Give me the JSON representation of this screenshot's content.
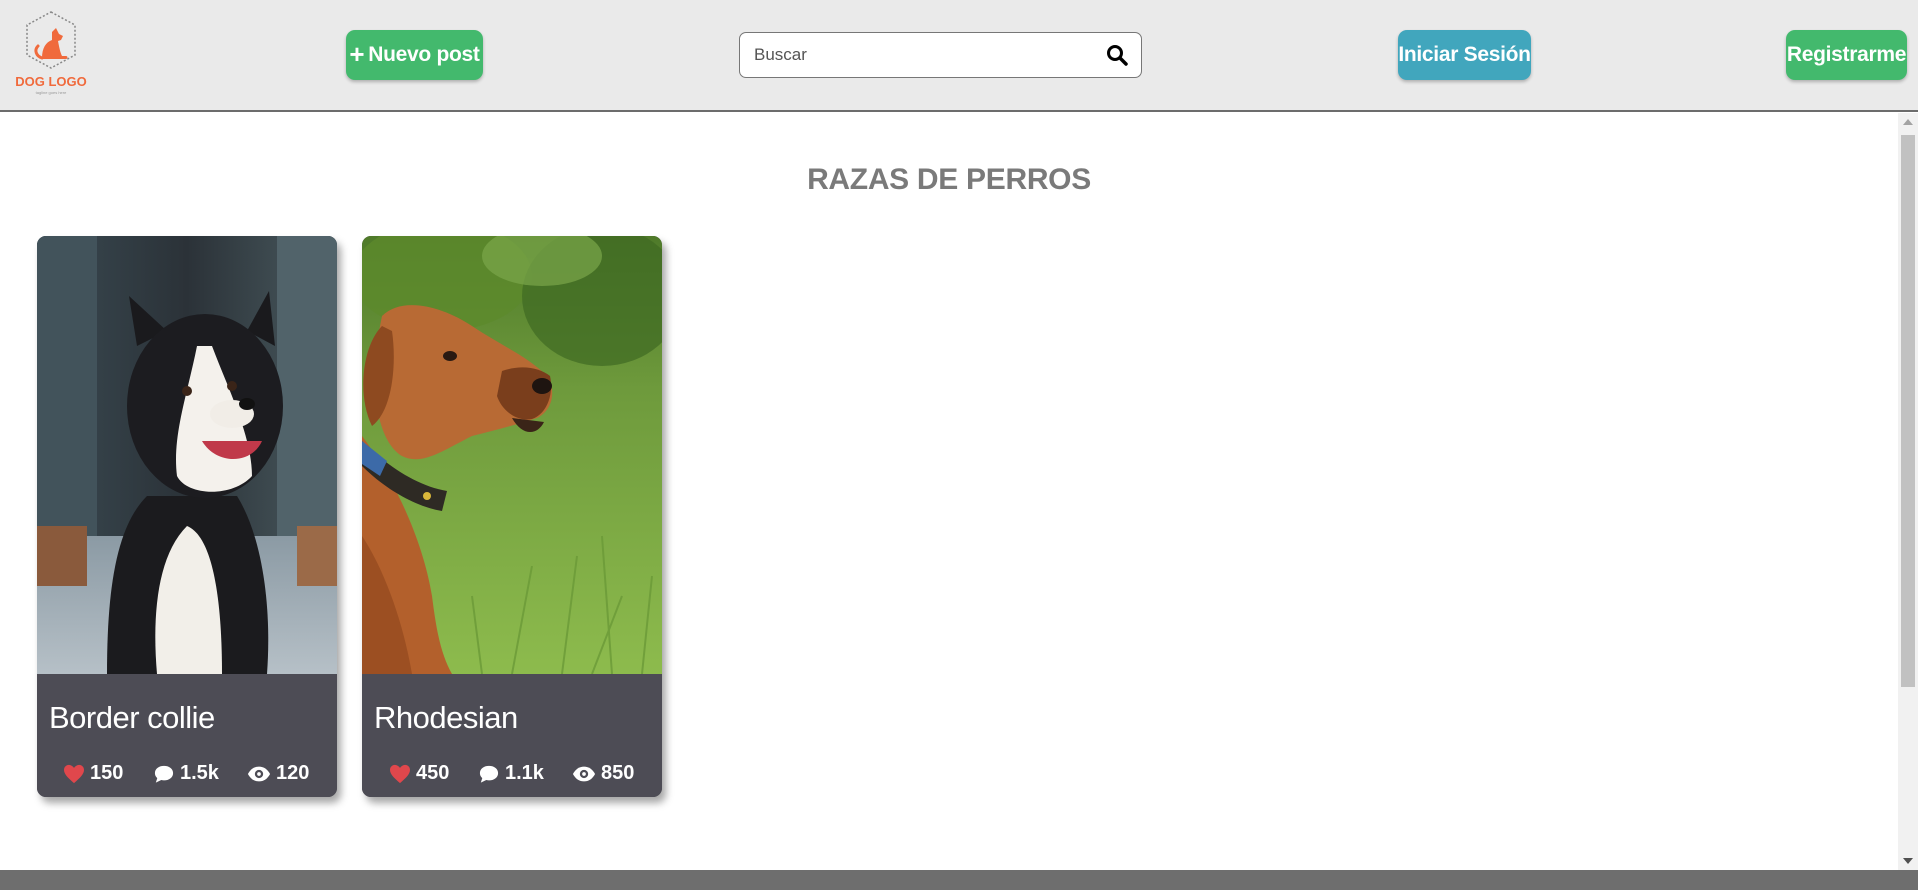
{
  "header": {
    "logo": {
      "text": "DOG LOGO",
      "tagline": "tagline goes here",
      "icon": "dog-logo-icon"
    },
    "new_post_label": "Nuevo post",
    "search": {
      "placeholder": "Buscar",
      "value": ""
    },
    "login_label": "Iniciar Sesión",
    "register_label": "Registrarme"
  },
  "main": {
    "title": "RAZAS DE PERROS",
    "cards": [
      {
        "title": "Border collie",
        "likes": "150",
        "comments": "1.5k",
        "views": "120"
      },
      {
        "title": "Rhodesian",
        "likes": "450",
        "comments": "1.1k",
        "views": "850"
      }
    ]
  },
  "colors": {
    "header_bg": "#eaeaea",
    "green": "#43b96d",
    "teal": "#41a6bd",
    "card_bg": "#4d4c55",
    "heart": "#e0474c",
    "logo": "#f06a3c"
  }
}
